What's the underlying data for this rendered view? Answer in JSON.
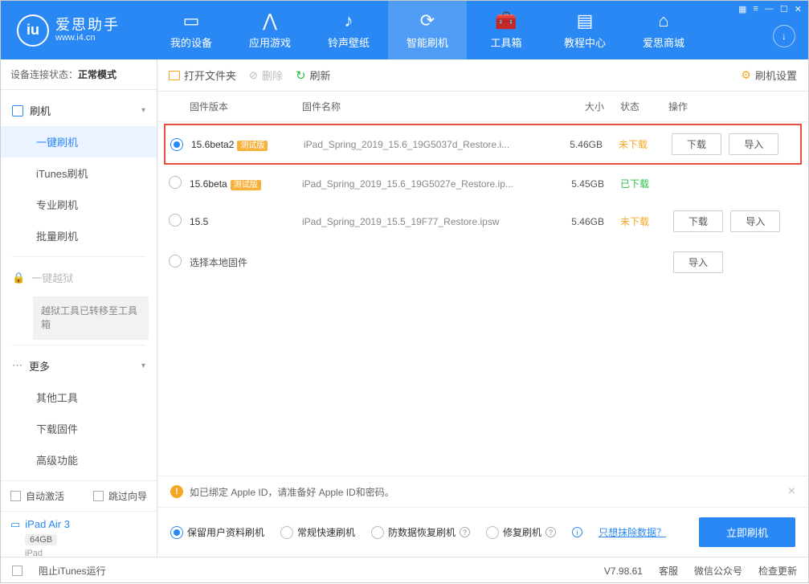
{
  "app": {
    "title": "爱思助手",
    "url": "www.i4.cn"
  },
  "nav": [
    {
      "label": "我的设备"
    },
    {
      "label": "应用游戏"
    },
    {
      "label": "铃声壁纸"
    },
    {
      "label": "智能刷机"
    },
    {
      "label": "工具箱"
    },
    {
      "label": "教程中心"
    },
    {
      "label": "爱思商城"
    }
  ],
  "conn": {
    "prefix": "设备连接状态：",
    "status": "正常模式"
  },
  "side": {
    "flash": "刷机",
    "items1": [
      "一键刷机",
      "iTunes刷机",
      "专业刷机",
      "批量刷机"
    ],
    "jb": "一键越狱",
    "jb_note": "越狱工具已转移至工具箱",
    "more": "更多",
    "items2": [
      "其他工具",
      "下载固件",
      "高级功能"
    ],
    "auto_activate": "自动激活",
    "skip_guide": "跳过向导",
    "device_name": "iPad Air 3",
    "device_cap": "64GB",
    "device_type": "iPad"
  },
  "toolbar": {
    "open": "打开文件夹",
    "delete": "删除",
    "refresh": "刷新",
    "settings": "刷机设置"
  },
  "cols": {
    "ver": "固件版本",
    "name": "固件名称",
    "size": "大小",
    "status": "状态",
    "ops": "操作"
  },
  "rows": [
    {
      "ver": "15.6beta2",
      "beta": "测试版",
      "name": "iPad_Spring_2019_15.6_19G5037d_Restore.i...",
      "size": "5.46GB",
      "status": "未下载",
      "status_cls": "stat-undown",
      "selected": true,
      "ops": true
    },
    {
      "ver": "15.6beta",
      "beta": "测试版",
      "name": "iPad_Spring_2019_15.6_19G5027e_Restore.ip...",
      "size": "5.45GB",
      "status": "已下载",
      "status_cls": "stat-down",
      "selected": false,
      "ops": false
    },
    {
      "ver": "15.5",
      "beta": "",
      "name": "iPad_Spring_2019_15.5_19F77_Restore.ipsw",
      "size": "5.46GB",
      "status": "未下载",
      "status_cls": "stat-undown",
      "selected": false,
      "ops": true
    }
  ],
  "local_row": "选择本地固件",
  "btn": {
    "download": "下载",
    "import": "导入"
  },
  "notice": "如已绑定 Apple ID，请准备好 Apple ID和密码。",
  "options": {
    "o1": "保留用户资料刷机",
    "o2": "常规快速刷机",
    "o3": "防数据恢复刷机",
    "o4": "修复刷机",
    "erase": "只想抹除数据？",
    "go": "立即刷机"
  },
  "footer": {
    "block_itunes": "阻止iTunes运行",
    "version": "V7.98.61",
    "kf": "客服",
    "wechat": "微信公众号",
    "update": "检查更新"
  }
}
